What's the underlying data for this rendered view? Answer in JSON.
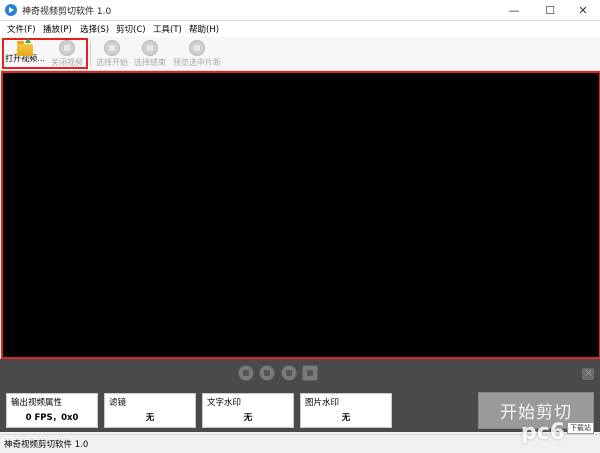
{
  "window": {
    "title": "神奇视频剪切软件 1.0",
    "minimize_glyph": "—",
    "maximize_glyph": "☐",
    "close_glyph": "✕",
    "icon": "app-play-icon"
  },
  "menu": {
    "items": [
      {
        "label": "文件(F)"
      },
      {
        "label": "播放(P)"
      },
      {
        "label": "选择(S)"
      },
      {
        "label": "剪切(C)"
      },
      {
        "label": "工具(T)"
      },
      {
        "label": "帮助(H)"
      }
    ]
  },
  "toolbar": {
    "buttons": [
      {
        "label": "打开视频...",
        "icon": "open-folder-icon",
        "enabled": true
      },
      {
        "label": "关闭视频",
        "icon": "close-video-icon",
        "enabled": false
      },
      {
        "label": "选择开始",
        "icon": "select-start-icon",
        "enabled": false
      },
      {
        "label": "选择结束",
        "icon": "select-end-icon",
        "enabled": false
      },
      {
        "label": "预览选中片断",
        "icon": "preview-selection-icon",
        "enabled": false
      }
    ]
  },
  "panels": {
    "output": {
      "heading": "输出视频属性",
      "value": "0 FPS，0x0"
    },
    "filter": {
      "heading": "滤镜",
      "value": "无"
    },
    "text_watermark": {
      "heading": "文字水印",
      "value": "无"
    },
    "image_watermark": {
      "heading": "图片水印",
      "value": "无"
    }
  },
  "start_button": {
    "label": "开始剪切"
  },
  "status": {
    "text": "神奇视频剪切软件 1.0"
  },
  "watermark": {
    "main": "pc6",
    "sub": "下载站"
  },
  "colors": {
    "highlight_border": "#e32121",
    "video_bg": "#000000",
    "band_bg": "#4a4a4a",
    "start_button_bg": "#9a9a9a"
  }
}
